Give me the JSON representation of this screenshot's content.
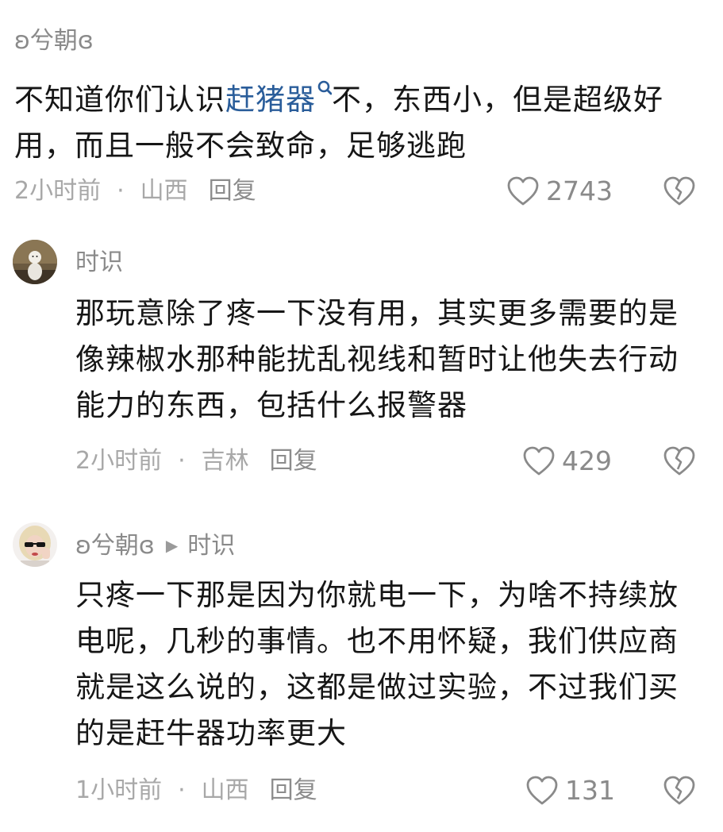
{
  "comments": [
    {
      "username": "ʚ兮朝ɞ",
      "reply_to": "",
      "text_before": "不知道你们认识",
      "link_text": "赶猪器",
      "text_after": "不，东西小，但是超级好用，而且一般不会致命，足够逃跑",
      "time": "2小时前",
      "location": "山西",
      "reply_label": "回复",
      "likes": "2743"
    },
    {
      "username": "时识",
      "reply_to": "",
      "text": "那玩意除了疼一下没有用，其实更多需要的是像辣椒水那种能扰乱视线和暂时让他失去行动能力的东西，包括什么报警器",
      "time": "2小时前",
      "location": "吉林",
      "reply_label": "回复",
      "likes": "429"
    },
    {
      "username": "ʚ兮朝ɞ",
      "reply_to": "时识",
      "text": "只疼一下那是因为你就电一下，为啥不持续放电呢，几秒的事情。也不用怀疑，我们供应商就是这么说的，这都是做过实验，不过我们买的是赶牛器功率更大",
      "time": "1小时前",
      "location": "山西",
      "reply_label": "回复",
      "likes": "131"
    }
  ],
  "icons": {
    "like": "heart-outline-icon",
    "dislike": "broken-heart-icon",
    "search": "search-icon"
  },
  "colors": {
    "link": "#2a5d9a",
    "meta": "#a8a8a8",
    "text": "#161616"
  }
}
